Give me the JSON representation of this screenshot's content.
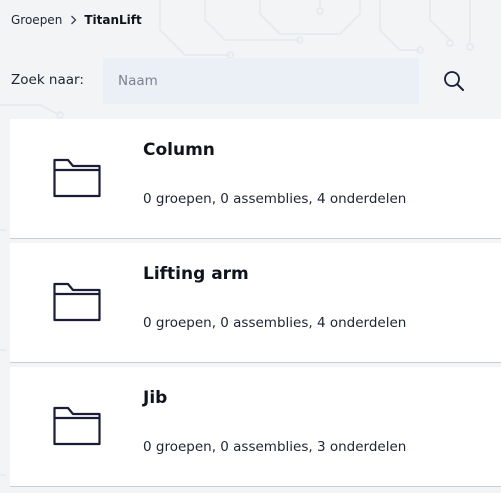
{
  "breadcrumb": {
    "parent": "Groepen",
    "current": "TitanLift"
  },
  "search": {
    "label": "Zoek naar:",
    "placeholder": "Naam",
    "value": ""
  },
  "groups": [
    {
      "name": "Column",
      "summary": "0 groepen, 0 assemblies, 4 onderdelen"
    },
    {
      "name": "Lifting arm",
      "summary": "0 groepen, 0 assemblies, 4 onderdelen"
    },
    {
      "name": "Jib",
      "summary": "0 groepen, 0 assemblies, 3 onderdelen"
    }
  ],
  "icons": {
    "breadcrumb_separator": "chevron-right-icon",
    "search": "search-icon",
    "group": "folder-icon"
  },
  "colors": {
    "page_background": "#f2f4f6",
    "card_background": "#ffffff",
    "search_background": "#eaf0f6",
    "text": "#1f2433",
    "icon_stroke": "#1b1c36"
  }
}
